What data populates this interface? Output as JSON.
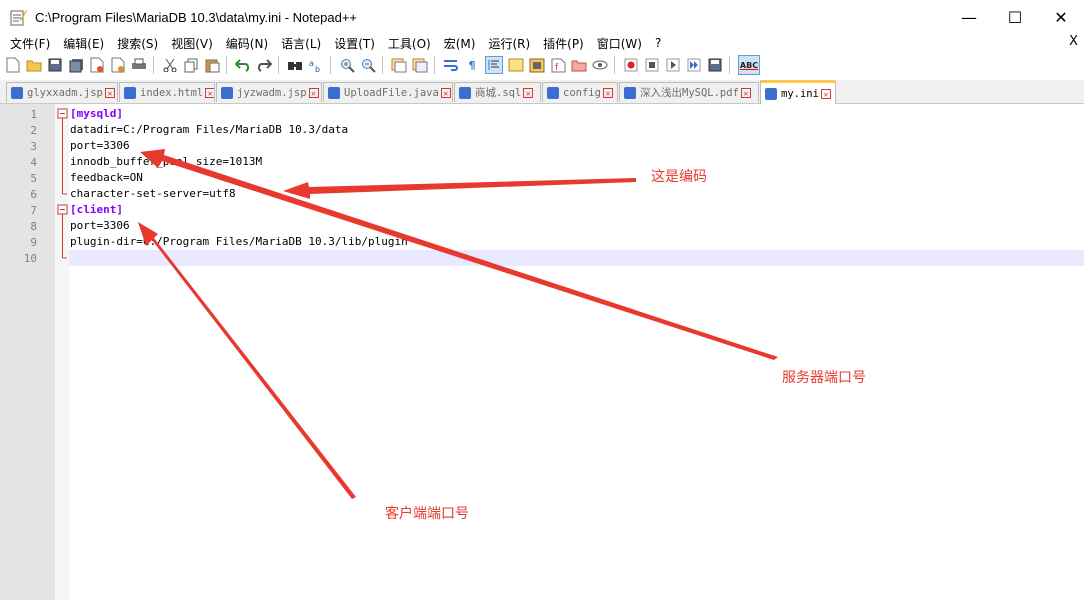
{
  "window": {
    "title": "C:\\Program Files\\MariaDB 10.3\\data\\my.ini - Notepad++",
    "buttons": [
      "—",
      "☐",
      "✕"
    ]
  },
  "menu": {
    "items": [
      "文件(F)",
      "编辑(E)",
      "搜索(S)",
      "视图(V)",
      "编码(N)",
      "语言(L)",
      "设置(T)",
      "工具(O)",
      "宏(M)",
      "运行(R)",
      "插件(P)",
      "窗口(W)",
      "?"
    ],
    "close": "X"
  },
  "toolbar": {
    "icons": [
      "new-file-icon",
      "open-file-icon",
      "save-icon",
      "save-all-icon",
      "close-icon",
      "close-all-icon",
      "print-icon",
      "cut-icon",
      "copy-icon",
      "paste-icon",
      "undo-icon",
      "redo-icon",
      "find-icon",
      "replace-icon",
      "zoom-in-icon",
      "zoom-out-icon",
      "sync-v-icon",
      "sync-h-icon",
      "wrap-icon",
      "show-all-chars-icon",
      "indent-guide-icon",
      "udl-icon",
      "doc-map-icon",
      "function-list-icon",
      "folder-icon",
      "monitor-icon",
      "record-icon",
      "stop-icon",
      "play-icon",
      "play-multi-icon",
      "save-macro-icon",
      "spellcheck-icon"
    ],
    "spell_label": "ABC"
  },
  "tabs": [
    {
      "label": "glyxxadm.jsp"
    },
    {
      "label": "index.html"
    },
    {
      "label": "jyzwadm.jsp"
    },
    {
      "label": "UploadFile.java"
    },
    {
      "label": "商城.sql"
    },
    {
      "label": "config"
    },
    {
      "label": "深入浅出MySQL.pdf"
    },
    {
      "label": "my.ini"
    }
  ],
  "editor": {
    "lines": [
      {
        "n": "1",
        "text": "[mysqld]",
        "type": "section"
      },
      {
        "n": "2",
        "key": "datadir",
        "value": "C:/Program Files/MariaDB 10.3/data"
      },
      {
        "n": "3",
        "key": "port",
        "value": "3306"
      },
      {
        "n": "4",
        "key": "innodb_buffer_pool_size",
        "value": "1013M"
      },
      {
        "n": "5",
        "key": "feedback",
        "value": "ON"
      },
      {
        "n": "6",
        "key": "character-set-server",
        "value": "utf8"
      },
      {
        "n": "7",
        "text": "[client]",
        "type": "section"
      },
      {
        "n": "8",
        "key": "port",
        "value": "3306"
      },
      {
        "n": "9",
        "key": "plugin-dir",
        "value": "C:/Program Files/MariaDB 10.3/lib/plugin"
      },
      {
        "n": "10",
        "text": ""
      }
    ]
  },
  "annotations": {
    "encoding": "这是编码",
    "server_port": "服务器端口号",
    "client_port": "客户端端口号",
    "color": "#e8392e"
  }
}
